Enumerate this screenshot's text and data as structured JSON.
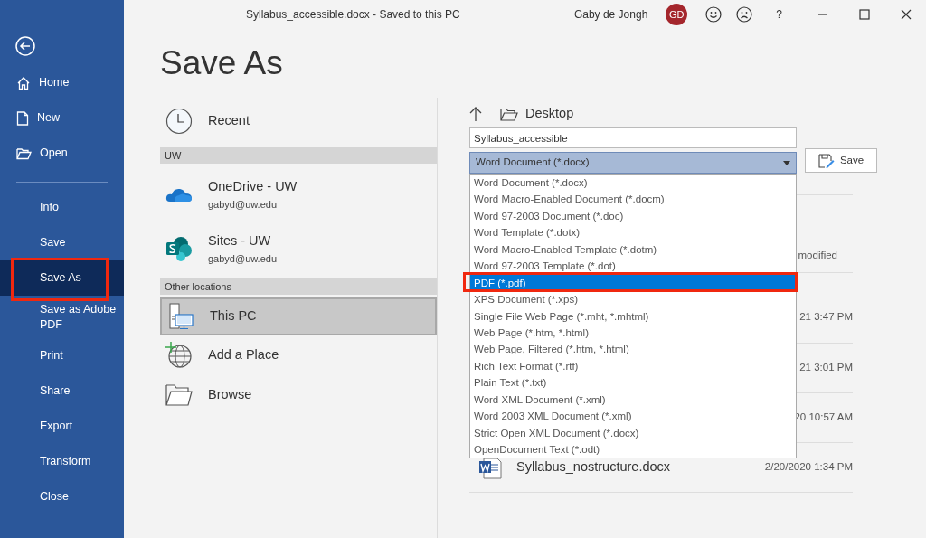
{
  "window": {
    "title": "Syllabus_accessible.docx  -  Saved to this PC",
    "user": "Gaby de Jongh",
    "avatar_initials": "GD",
    "help": "?"
  },
  "sidebar": {
    "top_items": [
      {
        "kind": "home",
        "label": "Home",
        "selected": false,
        "highlighted": false
      },
      {
        "kind": "new",
        "label": "New",
        "selected": false,
        "highlighted": false
      },
      {
        "kind": "open",
        "label": "Open",
        "selected": false,
        "highlighted": false
      }
    ],
    "items": [
      {
        "label": "Info",
        "selected": false,
        "highlighted": false
      },
      {
        "label": "Save",
        "selected": false,
        "highlighted": false
      },
      {
        "label": "Save As",
        "selected": true,
        "highlighted": true
      },
      {
        "label": "Save as Adobe PDF",
        "selected": false,
        "highlighted": false
      },
      {
        "label": "Print",
        "selected": false,
        "highlighted": false
      },
      {
        "label": "Share",
        "selected": false,
        "highlighted": false
      },
      {
        "label": "Export",
        "selected": false,
        "highlighted": false
      },
      {
        "label": "Transform",
        "selected": false,
        "highlighted": false
      },
      {
        "label": "Close",
        "selected": false,
        "highlighted": false
      }
    ]
  },
  "page_title": "Save As",
  "locations": [
    {
      "kind": "recent",
      "label": "Recent",
      "selected": false
    },
    {
      "kind": "group",
      "label": "UW"
    },
    {
      "kind": "onedrive",
      "label": "OneDrive - UW",
      "account": "gabyd@uw.edu",
      "selected": false
    },
    {
      "kind": "sites",
      "label": "Sites - UW",
      "account": "gabyd@uw.edu",
      "selected": false
    },
    {
      "kind": "group",
      "label": "Other locations"
    },
    {
      "kind": "pc",
      "label": "This PC",
      "selected": true
    },
    {
      "kind": "add",
      "label": "Add a Place",
      "selected": false
    },
    {
      "kind": "browse",
      "label": "Browse",
      "selected": false
    }
  ],
  "save_pane": {
    "folder": "Desktop",
    "file_name": "Syllabus_accessible",
    "file_type": "Word Document (*.docx)",
    "expanded": true,
    "save_button": "Save",
    "file_type_options": [
      {
        "label": "Word Document (*.docx)",
        "selected": false,
        "highlighted": false
      },
      {
        "label": "Word Macro-Enabled Document (*.docm)",
        "selected": false,
        "highlighted": false
      },
      {
        "label": "Word 97-2003 Document (*.doc)",
        "selected": false,
        "highlighted": false
      },
      {
        "label": "Word Template (*.dotx)",
        "selected": false,
        "highlighted": false
      },
      {
        "label": "Word Macro-Enabled Template (*.dotm)",
        "selected": false,
        "highlighted": false
      },
      {
        "label": "Word 97-2003 Template (*.dot)",
        "selected": false,
        "highlighted": false
      },
      {
        "label": "PDF (*.pdf)",
        "selected": true,
        "highlighted": true
      },
      {
        "label": "XPS Document (*.xps)",
        "selected": false,
        "highlighted": false
      },
      {
        "label": "Single File Web Page (*.mht, *.mhtml)",
        "selected": false,
        "highlighted": false
      },
      {
        "label": "Web Page (*.htm, *.html)",
        "selected": false,
        "highlighted": false
      },
      {
        "label": "Web Page, Filtered (*.htm, *.html)",
        "selected": false,
        "highlighted": false
      },
      {
        "label": "Rich Text Format (*.rtf)",
        "selected": false,
        "highlighted": false
      },
      {
        "label": "Plain Text (*.txt)",
        "selected": false,
        "highlighted": false
      },
      {
        "label": "Word XML Document (*.xml)",
        "selected": false,
        "highlighted": false
      },
      {
        "label": "Word 2003 XML Document (*.xml)",
        "selected": false,
        "highlighted": false
      },
      {
        "label": "Strict Open XML Document (*.docx)",
        "selected": false,
        "highlighted": false
      },
      {
        "label": "OpenDocument Text (*.odt)",
        "selected": false,
        "highlighted": false
      }
    ],
    "files_header": {
      "date": "modified"
    },
    "files": [
      {
        "date": "21 3:47 PM"
      },
      {
        "date": "21 3:01 PM"
      },
      {
        "date": "20 10:57 AM"
      },
      {
        "kind": "word",
        "name": "Syllabus_nostructure.docx",
        "date": "2/20/2020 1:34 PM"
      }
    ]
  }
}
